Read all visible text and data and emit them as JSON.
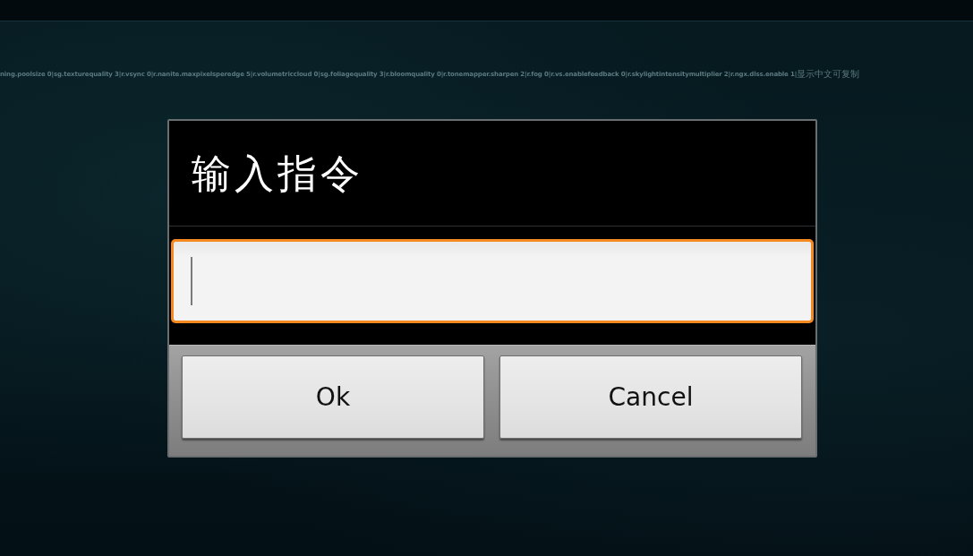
{
  "console_line": {
    "text": "ning.poolsize 0|sg.texturequality 3|r.vsync 0|r.nanite.maxpixelsperedge 5|r.volumetriccloud 0|sg.foliagequality 3|r.bloomquality 0|r.tonemapper.sharpen 2|r.fog 0|r.vs.enablefeedback 0|r.skylightintensitymultiplier 2|r.ngx.dlss.enable 1|",
    "note": "显示中文可复制"
  },
  "dialog": {
    "title": "输入指令",
    "input": {
      "focused": true
    },
    "buttons": [
      "Ok",
      "Cancel"
    ]
  }
}
